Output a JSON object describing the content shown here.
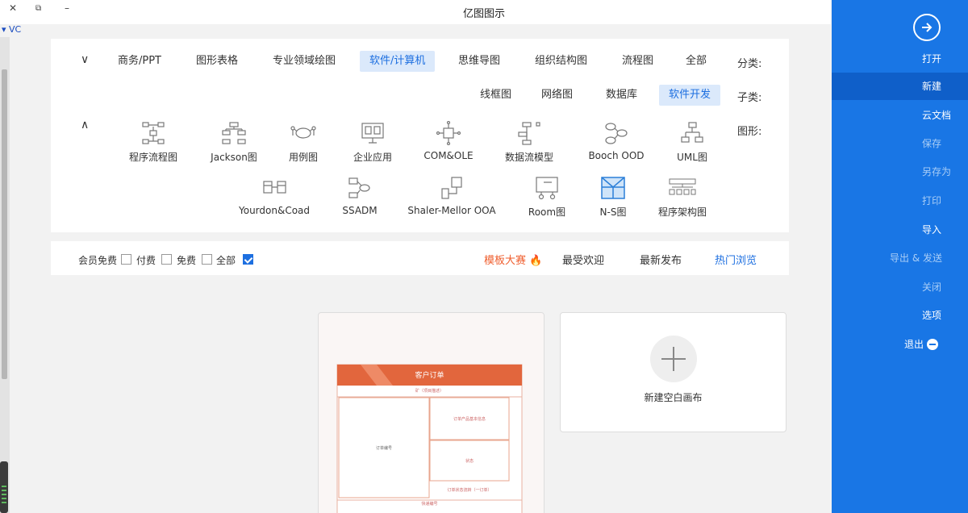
{
  "window": {
    "title": "亿图图示",
    "close_glyph": "✕",
    "minimize_glyph": "–",
    "restore_glyph": "⧉",
    "tab_label": "VC"
  },
  "sidebar": {
    "open_label": "打开",
    "items": [
      {
        "label": "新建"
      },
      {
        "label": "云文档"
      },
      {
        "label": "保存"
      },
      {
        "label": "另存为"
      },
      {
        "label": "打印"
      },
      {
        "label": "导入"
      },
      {
        "label": "导出 & 发送"
      },
      {
        "label": "关闭"
      },
      {
        "label": "选项"
      },
      {
        "label": "退出"
      }
    ]
  },
  "category": {
    "label": "分类:",
    "items": [
      "全部",
      "流程图",
      "组织结构图",
      "思维导图",
      "软件/计算机",
      "专业领域绘图",
      "图形表格",
      "商务/PPT"
    ],
    "active": "软件/计算机"
  },
  "subcategory": {
    "label": "子类:",
    "items": [
      "软件开发",
      "数据库",
      "网络图",
      "线框图"
    ],
    "active": "软件开发"
  },
  "shapes": {
    "label": "图形:",
    "row1": [
      "UML图",
      "Booch OOD",
      "数据流模型",
      "COM&OLE",
      "企业应用",
      "用例图",
      "Jackson图",
      "程序流程图"
    ],
    "row2": [
      "程序架构图",
      "N-S图",
      "Room图",
      "Shaler-Mellor OOA",
      "SSADM",
      "Yourdon&Coad"
    ]
  },
  "filters": {
    "tabs": [
      "热门浏览",
      "最新发布",
      "最受欢迎",
      "模板大赛"
    ],
    "active_tab": "热门浏览",
    "checkboxes": [
      {
        "label": "全部",
        "checked": true
      },
      {
        "label": "免费",
        "checked": false
      },
      {
        "label": "付费",
        "checked": false
      },
      {
        "label": "会员免费",
        "checked": false
      }
    ]
  },
  "new_card": {
    "label": "新建空白画布"
  },
  "template": {
    "title": "客户订单",
    "subtitle": "矿（项目描述）",
    "box_left": "订单编号",
    "box_right_top": "订单产品基本信息",
    "box_right_mid": "状态",
    "footer": "订单状态流转（一订单）",
    "section2": "快递编号"
  },
  "colors": {
    "accent": "#1d6fe0",
    "sidebar": "#1976e5",
    "hot": "#ef5e2e",
    "template_orange": "#e2663d"
  }
}
